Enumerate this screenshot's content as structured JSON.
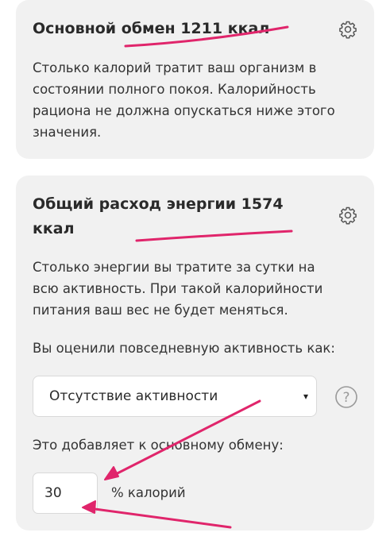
{
  "basal": {
    "title": "Основной обмен 1211 ккал",
    "description_lines": [
      "Столько калорий тратит ваш организм в",
      "состоянии полного покоя. Калорийность",
      "рациона не должна опускаться ниже этого",
      "значения."
    ],
    "settings_icon": "gear-icon"
  },
  "total": {
    "title_lines": [
      "Общий расход энергии 1574",
      "ккал"
    ],
    "description_lines": [
      "Столько энергии вы тратите за сутки на",
      "всю активность. При такой калорийности",
      "питания ваш вес не будет меняться."
    ],
    "settings_icon": "gear-icon",
    "activity_prompt": "Вы оценили повседневную активность как:",
    "activity_select": {
      "selected": "Отсутствие активности",
      "arrow": "▾"
    },
    "help_icon": "question-circle-icon",
    "help_glyph": "?",
    "adds_label": "Это добавляет к основному обмену:",
    "percent_input_value": "30",
    "percent_unit": "% калорий"
  },
  "annotations": {
    "color": "#e0256b"
  }
}
